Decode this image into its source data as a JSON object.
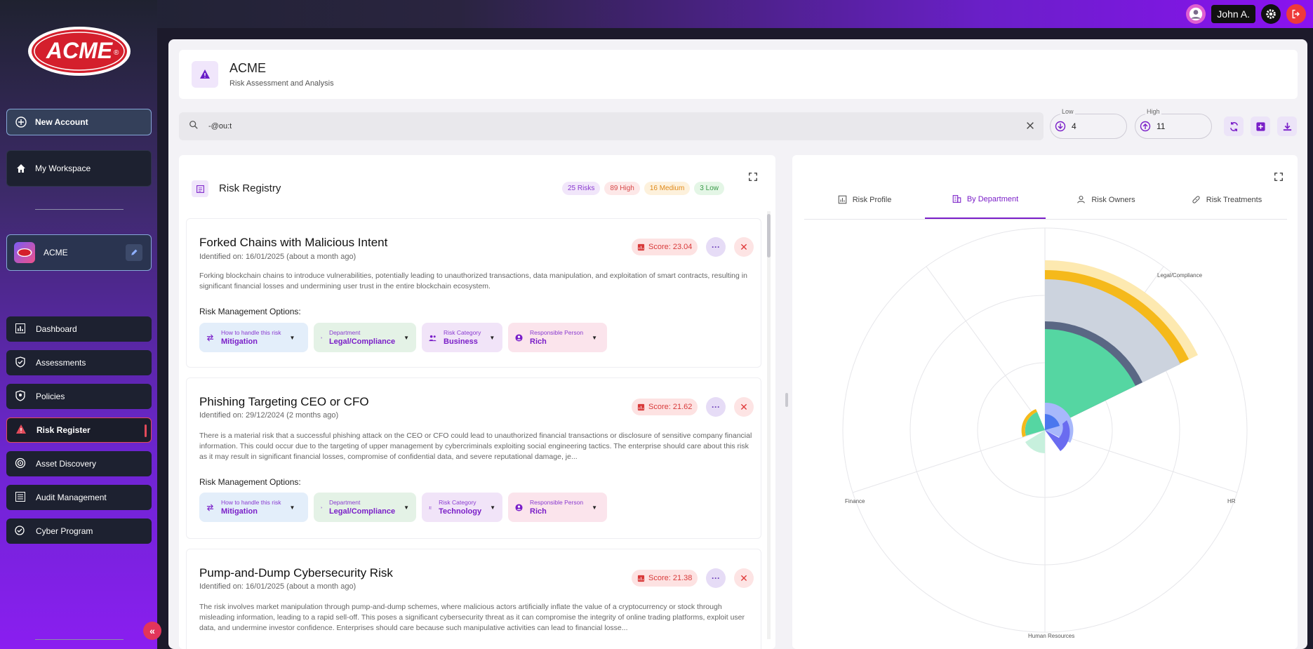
{
  "app": {
    "brand": "ACME",
    "user_name": "John A.",
    "icons": {
      "user": "user-circle-icon",
      "settings": "gear-icon",
      "logout": "logout-icon"
    }
  },
  "sidebar": {
    "new_account": "New Account",
    "workspace": "My Workspace",
    "org_name": "ACME",
    "nav": [
      {
        "label": "Dashboard",
        "icon": "bar-chart-icon"
      },
      {
        "label": "Assessments",
        "icon": "shield-check-icon"
      },
      {
        "label": "Policies",
        "icon": "shield-icon"
      },
      {
        "label": "Risk Register",
        "icon": "warning-icon",
        "active": true
      },
      {
        "label": "Asset Discovery",
        "icon": "radar-icon"
      },
      {
        "label": "Audit Management",
        "icon": "list-icon"
      },
      {
        "label": "Cyber Program",
        "icon": "check-gear-icon"
      }
    ],
    "collapse_label": "«"
  },
  "header": {
    "title": "ACME",
    "subtitle": "Risk Assessment and Analysis"
  },
  "search": {
    "value": "-@ou:t",
    "low_label": "Low",
    "low_value": "4",
    "high_label": "High",
    "high_value": "11"
  },
  "registry": {
    "title": "Risk Registry",
    "badges": {
      "risks": "25 Risks",
      "high": "89 High",
      "medium": "16 Medium",
      "low": "3 Low"
    },
    "options_heading": "Risk Management Options:",
    "chip_labels": {
      "handle": "How to handle this risk",
      "department": "Department",
      "category": "Risk Category",
      "person": "Responsible Person"
    },
    "more_label": "···",
    "close_label": "✕",
    "risks": [
      {
        "title": "Forked Chains with Malicious Intent",
        "identified": "Identified on: 16/01/2025 (about a month ago)",
        "score": "Score: 23.04",
        "description": "Forking blockchain chains to introduce vulnerabilities, potentially leading to unauthorized transactions, data manipulation, and exploitation of smart contracts, resulting in significant financial losses and undermining user trust in the entire blockchain ecosystem.",
        "handle": "Mitigation",
        "department": "Legal/Compliance",
        "category": "Business",
        "person": "Rich"
      },
      {
        "title": "Phishing Targeting CEO or CFO",
        "identified": "Identified on: 29/12/2024 (2 months ago)",
        "score": "Score: 21.62",
        "description": "There is a material risk that a successful phishing attack on the CEO or CFO could lead to unauthorized financial transactions or disclosure of sensitive company financial information. This could occur due to the targeting of upper management by cybercriminals exploiting social engineering tactics. The enterprise should care about this risk as it may result in significant financial losses, compromise of confidential data, and severe reputational damage, je...",
        "handle": "Mitigation",
        "department": "Legal/Compliance",
        "category": "Technology",
        "person": "Rich"
      },
      {
        "title": "Pump-and-Dump Cybersecurity Risk",
        "identified": "Identified on: 16/01/2025 (about a month ago)",
        "score": "Score: 21.38",
        "description": "The risk involves market manipulation through pump-and-dump schemes, where malicious actors artificially inflate the value of a cryptocurrency or stock through misleading information, leading to a rapid sell-off. This poses a significant cybersecurity threat as it can compromise the integrity of online trading platforms, exploit user data, and undermine investor confidence. Enterprises should care because such manipulative activities can lead to financial losse..."
      }
    ]
  },
  "chart_panel": {
    "tabs": [
      {
        "label": "Risk Profile",
        "icon": "chart-icon"
      },
      {
        "label": "By Department",
        "icon": "building-icon",
        "active": true
      },
      {
        "label": "Risk Owners",
        "icon": "person-icon"
      },
      {
        "label": "Risk Treatments",
        "icon": "bandage-icon"
      }
    ]
  },
  "chart_data": {
    "type": "polar-area",
    "categories": [
      "Legal/Compliance",
      "HR",
      "Human Resources",
      "Finance"
    ],
    "colors": [
      "#fde9b0",
      "#f5b91b",
      "#ccd3de",
      "#5a6784",
      "#55d6a2",
      "#a8b8fb",
      "#6a6cf0",
      "#c7f0dd",
      "#4b77ee"
    ]
  }
}
